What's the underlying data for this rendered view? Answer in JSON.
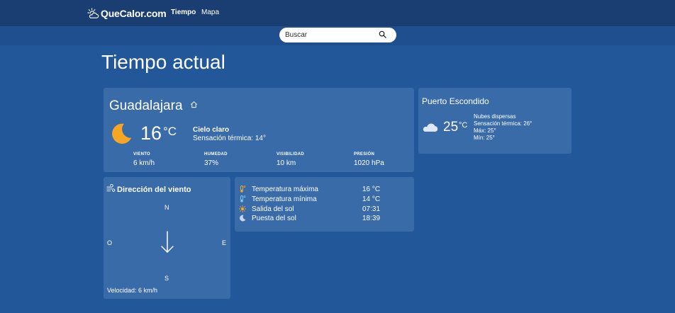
{
  "header": {
    "brand": "QueCalor.com",
    "nav": [
      "Tiempo",
      "Mapa"
    ]
  },
  "search": {
    "placeholder": "Buscar"
  },
  "page_title": "Tiempo actual",
  "main_city": {
    "name": "Guadalajara",
    "temp": "16",
    "unit": "°C",
    "condition": "Cielo claro",
    "feels_like": "Sensación térmica: 14°",
    "stats": [
      {
        "label": "VIENTO",
        "value": "6 km/h"
      },
      {
        "label": "HUMEDAD",
        "value": "37%"
      },
      {
        "label": "VISIBILIDAD",
        "value": "10 km"
      },
      {
        "label": "PRESIÓN",
        "value": "1020 hPa"
      }
    ]
  },
  "side_city": {
    "name": "Puerto Escondido",
    "temp": "25",
    "unit": "°C",
    "condition": "Nubes dispersas",
    "feels_like": "Sensación térmica: 26°",
    "max": "Máx: 25°",
    "min": "Mín: 25°"
  },
  "wind": {
    "title": "Dirección del viento",
    "north": "N",
    "south": "S",
    "east": "E",
    "west": "O",
    "speed": "Velocidad: 6 km/h"
  },
  "details": [
    {
      "icon": "thermometer-hot-icon",
      "label": "Temperatura máxima",
      "value": "16 °C"
    },
    {
      "icon": "thermometer-cold-icon",
      "label": "Temperatura mínima",
      "value": "14 °C"
    },
    {
      "icon": "sunrise-icon",
      "label": "Salida del sol",
      "value": "07:31"
    },
    {
      "icon": "moon-icon",
      "label": "Puesta del sol",
      "value": "18:39"
    }
  ],
  "colors": {
    "page_bg": "#22589a",
    "header_bg": "#1b3e72",
    "card_bg": "#3a6ba9",
    "moon": "#f5a623"
  }
}
